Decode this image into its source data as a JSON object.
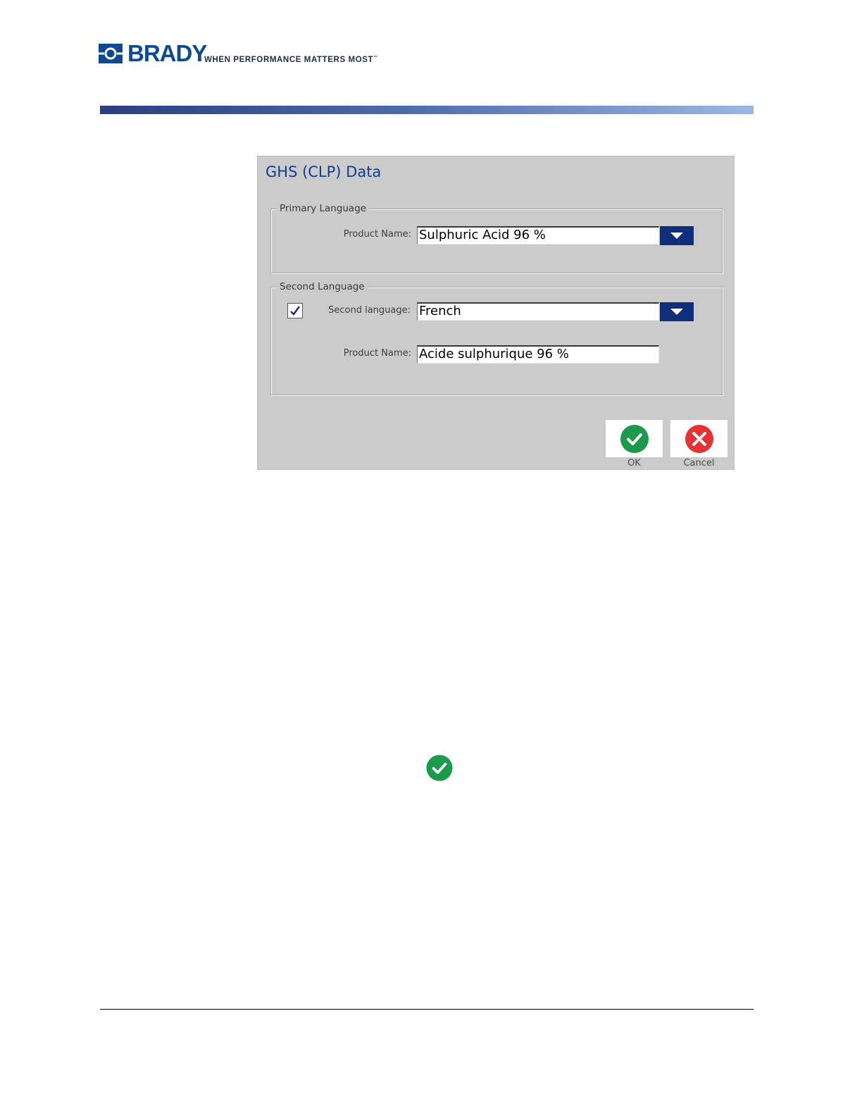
{
  "header": {
    "brand_name": "BRADY",
    "tagline": "WHEN PERFORMANCE MATTERS MOST",
    "trademark": "™",
    "brand_color": "#0d4a8f"
  },
  "dialog": {
    "title": "GHS (CLP) Data",
    "title_color": "#0f3e8f",
    "primary_group": {
      "legend": "Primary Language",
      "product_name_label": "Product Name:",
      "product_name_value": "Sulphuric Acid 96 %"
    },
    "second_group": {
      "legend": "Second Language",
      "enabled": true,
      "language_label": "Second language:",
      "language_value": "French",
      "product_name_label": "Product Name:",
      "product_name_value": "Acide sulphurique 96 %"
    },
    "buttons": {
      "ok_label": "OK",
      "cancel_label": "Cancel",
      "ok_color": "#1a9a4a",
      "cancel_color": "#e53333",
      "dropdown_color": "#102f7a"
    }
  },
  "icons": {
    "ok": "check-circle-icon",
    "cancel": "x-circle-icon",
    "dropdown": "chevron-down-icon",
    "inline": "check-circle-icon"
  }
}
